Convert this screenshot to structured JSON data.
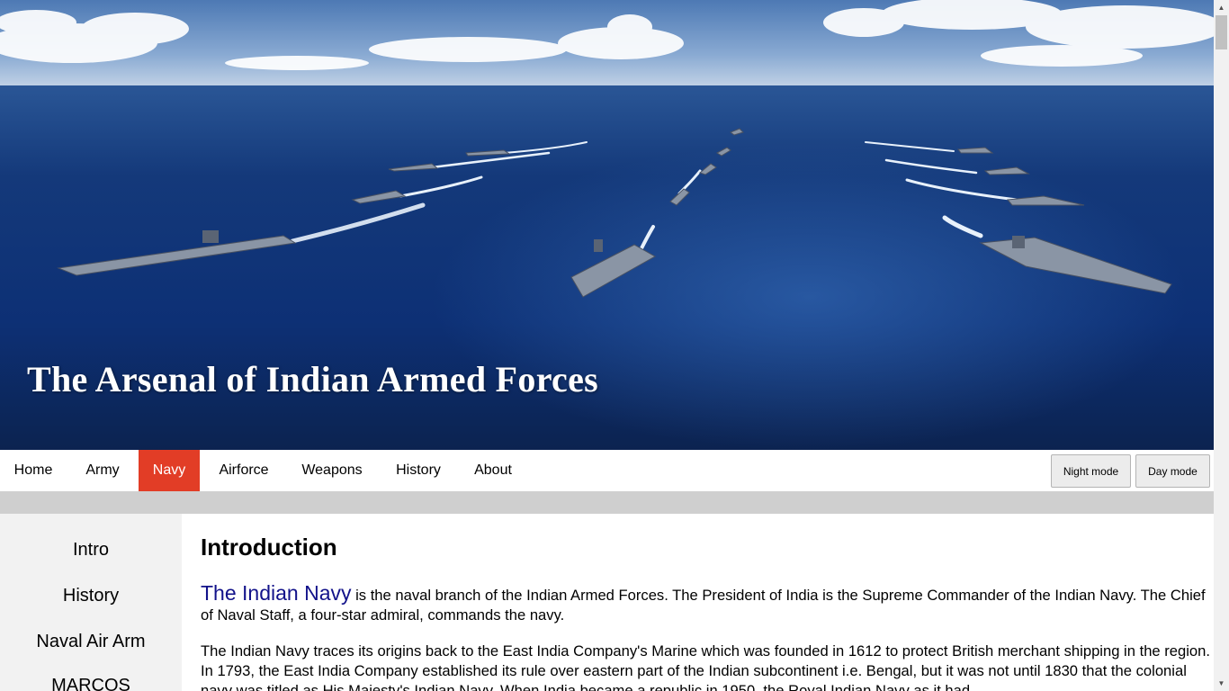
{
  "header": {
    "title": "The Arsenal of Indian Armed Forces"
  },
  "nav": {
    "links": [
      "Home",
      "Army",
      "Navy",
      "Airforce",
      "Weapons",
      "History",
      "About"
    ],
    "active": "Navy",
    "night_mode_label": "Night mode",
    "day_mode_label": "Day mode"
  },
  "sidebar": {
    "items": [
      "Intro",
      "History",
      "Naval Air Arm",
      "MARCOS"
    ]
  },
  "main": {
    "heading": "Introduction",
    "lead_term": "The Indian Navy",
    "p1_rest": " is the naval branch of the Indian Armed Forces. The President of India is the Supreme Commander of the Indian Navy. The Chief of Naval Staff, a four-star admiral, commands the navy.",
    "p2": "The Indian Navy traces its origins back to the East India Company's Marine which was founded in 1612 to protect British merchant shipping in the region. In 1793, the East India Company established its rule over eastern part of the Indian subcontinent i.e. Bengal, but it was not until 1830 that the colonial navy was titled as His Majesty's Indian Navy. When India became a republic in 1950, the Royal Indian Navy as it had"
  },
  "colors": {
    "active_nav": "#e23d26",
    "lead_term": "#12128a",
    "sidebar_bg": "#f2f2f2",
    "band": "#cfcfcf"
  },
  "icons": {
    "scroll_up": "triangle-up",
    "scroll_down": "triangle-down"
  }
}
